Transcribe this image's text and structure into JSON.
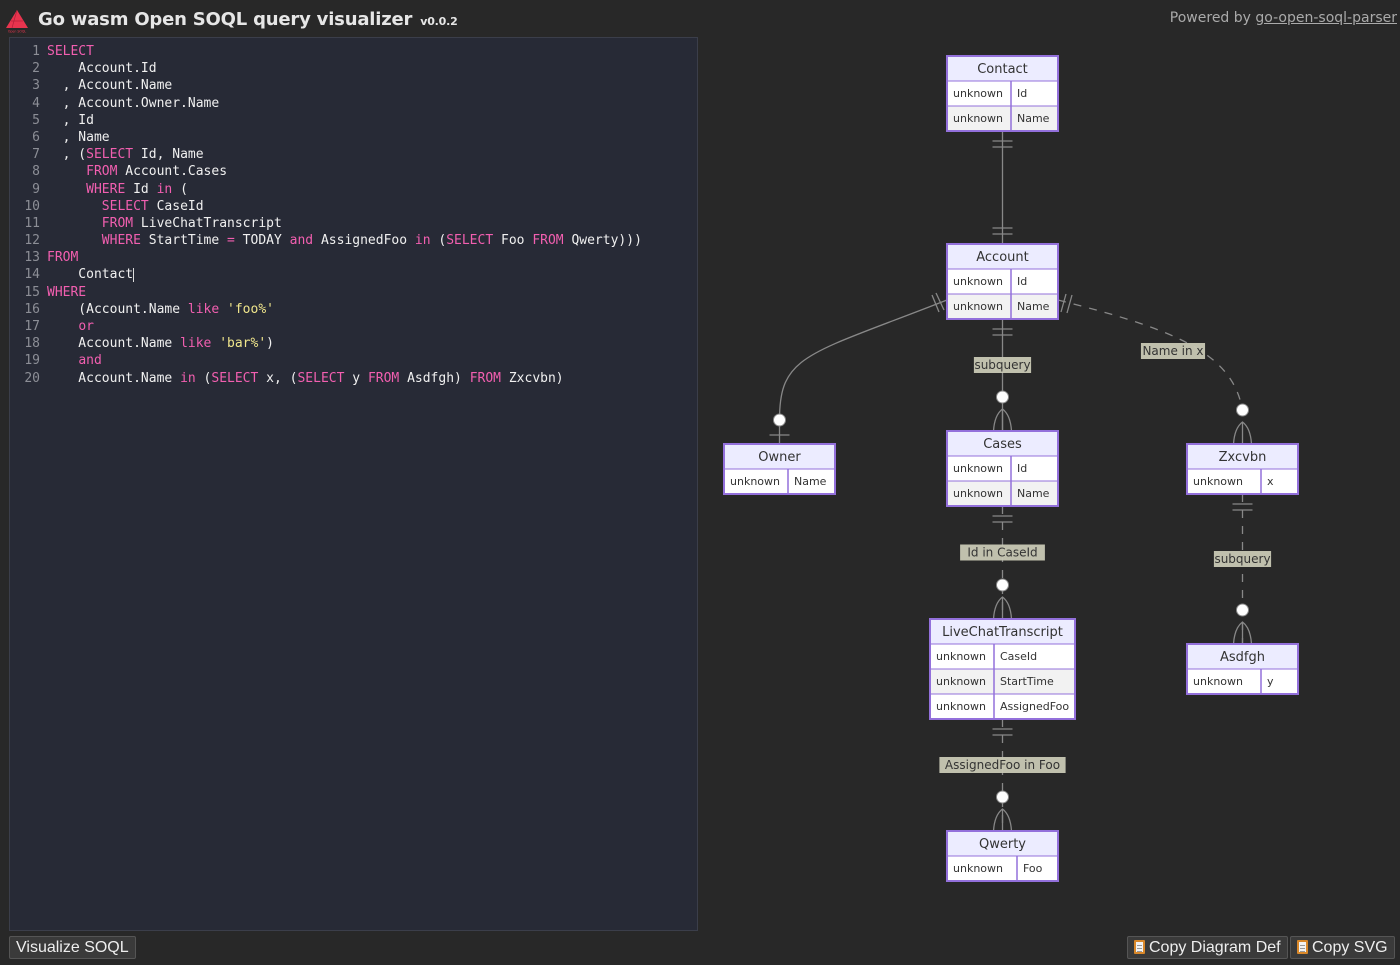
{
  "header": {
    "title": "Go wasm Open SOQL query visualizer",
    "version": "v0.0.2",
    "logo_caption": "Open SOQL",
    "powered_by_prefix": "Powered by",
    "powered_by_link": "go-open-soql-parser"
  },
  "editor": {
    "lines": [
      [
        {
          "t": "SELECT",
          "k": "kw"
        }
      ],
      [
        {
          "t": "    Account.Id"
        }
      ],
      [
        {
          "t": "  , Account.Name"
        }
      ],
      [
        {
          "t": "  , Account.Owner.Name"
        }
      ],
      [
        {
          "t": "  , Id"
        }
      ],
      [
        {
          "t": "  , Name"
        }
      ],
      [
        {
          "t": "  , ("
        },
        {
          "t": "SELECT",
          "k": "kw"
        },
        {
          "t": " Id, Name"
        }
      ],
      [
        {
          "t": "     "
        },
        {
          "t": "FROM",
          "k": "kw"
        },
        {
          "t": " Account.Cases"
        }
      ],
      [
        {
          "t": "     "
        },
        {
          "t": "WHERE",
          "k": "kw"
        },
        {
          "t": " Id "
        },
        {
          "t": "in",
          "k": "kw"
        },
        {
          "t": " ("
        }
      ],
      [
        {
          "t": "       "
        },
        {
          "t": "SELECT",
          "k": "kw"
        },
        {
          "t": " CaseId"
        }
      ],
      [
        {
          "t": "       "
        },
        {
          "t": "FROM",
          "k": "kw"
        },
        {
          "t": " LiveChatTranscript"
        }
      ],
      [
        {
          "t": "       "
        },
        {
          "t": "WHERE",
          "k": "kw"
        },
        {
          "t": " StartTime "
        },
        {
          "t": "=",
          "k": "kw"
        },
        {
          "t": " TODAY "
        },
        {
          "t": "and",
          "k": "kw"
        },
        {
          "t": " AssignedFoo "
        },
        {
          "t": "in",
          "k": "kw"
        },
        {
          "t": " ("
        },
        {
          "t": "SELECT",
          "k": "kw"
        },
        {
          "t": " Foo "
        },
        {
          "t": "FROM",
          "k": "kw"
        },
        {
          "t": " Qwerty)))"
        }
      ],
      [
        {
          "t": "FROM",
          "k": "kw"
        }
      ],
      [
        {
          "t": "    Contact",
          "cursor": true
        }
      ],
      [
        {
          "t": "WHERE",
          "k": "kw"
        }
      ],
      [
        {
          "t": "    (Account.Name "
        },
        {
          "t": "like",
          "k": "kw"
        },
        {
          "t": " "
        },
        {
          "t": "'foo%'",
          "k": "str"
        }
      ],
      [
        {
          "t": "    "
        },
        {
          "t": "or",
          "k": "kw"
        }
      ],
      [
        {
          "t": "    Account.Name "
        },
        {
          "t": "like",
          "k": "kw"
        },
        {
          "t": " "
        },
        {
          "t": "'bar%'",
          "k": "str"
        },
        {
          "t": ")"
        }
      ],
      [
        {
          "t": "    "
        },
        {
          "t": "and",
          "k": "kw"
        }
      ],
      [
        {
          "t": "    Account.Name "
        },
        {
          "t": "in",
          "k": "kw"
        },
        {
          "t": " ("
        },
        {
          "t": "SELECT",
          "k": "kw"
        },
        {
          "t": " x, ("
        },
        {
          "t": "SELECT",
          "k": "kw"
        },
        {
          "t": " y "
        },
        {
          "t": "FROM",
          "k": "kw"
        },
        {
          "t": " Asdfgh) "
        },
        {
          "t": "FROM",
          "k": "kw"
        },
        {
          "t": " Zxcvbn)"
        }
      ]
    ]
  },
  "buttons": {
    "visualize": "Visualize SOQL",
    "copy_def": "Copy Diagram Def",
    "copy_svg": "Copy SVG"
  },
  "diagram": {
    "colors": {
      "entity_header": "#ececff",
      "entity_border": "#9370db",
      "row_odd": "#ffffff",
      "row_even": "#f2f2f2",
      "edge": "#888888",
      "label_bg": "#c8c8b4",
      "marker_fill": "#ffffff"
    },
    "entities": [
      {
        "id": "Contact",
        "name": "Contact",
        "attrs": [
          [
            "unknown",
            "Id"
          ],
          [
            "unknown",
            "Name"
          ]
        ]
      },
      {
        "id": "Account",
        "name": "Account",
        "attrs": [
          [
            "unknown",
            "Id"
          ],
          [
            "unknown",
            "Name"
          ]
        ]
      },
      {
        "id": "Owner",
        "name": "Owner",
        "attrs": [
          [
            "unknown",
            "Name"
          ]
        ]
      },
      {
        "id": "Cases",
        "name": "Cases",
        "attrs": [
          [
            "unknown",
            "Id"
          ],
          [
            "unknown",
            "Name"
          ]
        ]
      },
      {
        "id": "Zxcvbn",
        "name": "Zxcvbn",
        "attrs": [
          [
            "unknown",
            "x"
          ]
        ]
      },
      {
        "id": "LiveChatTranscript",
        "name": "LiveChatTranscript",
        "attrs": [
          [
            "unknown",
            "CaseId"
          ],
          [
            "unknown",
            "StartTime"
          ],
          [
            "unknown",
            "AssignedFoo"
          ]
        ]
      },
      {
        "id": "Asdfgh",
        "name": "Asdfgh",
        "attrs": [
          [
            "unknown",
            "y"
          ]
        ]
      },
      {
        "id": "Qwerty",
        "name": "Qwerty",
        "attrs": [
          [
            "unknown",
            "Foo"
          ]
        ]
      }
    ],
    "relations": [
      {
        "from": "Contact",
        "to": "Account",
        "label": "",
        "dashed": false,
        "to_marker": "one"
      },
      {
        "from": "Account",
        "to": "Owner",
        "label": "",
        "dashed": false,
        "to_marker": "zero-one"
      },
      {
        "from": "Account",
        "to": "Cases",
        "label": "subquery",
        "dashed": false,
        "to_marker": "zero-many"
      },
      {
        "from": "Account",
        "to": "Zxcvbn",
        "label": "Name in x",
        "dashed": true,
        "to_marker": "zero-many"
      },
      {
        "from": "Cases",
        "to": "LiveChatTranscript",
        "label": "Id in CaseId",
        "dashed": true,
        "to_marker": "zero-many"
      },
      {
        "from": "Zxcvbn",
        "to": "Asdfgh",
        "label": "subquery",
        "dashed": true,
        "to_marker": "zero-many"
      },
      {
        "from": "LiveChatTranscript",
        "to": "Qwerty",
        "label": "AssignedFoo in Foo",
        "dashed": true,
        "to_marker": "zero-many"
      }
    ]
  }
}
